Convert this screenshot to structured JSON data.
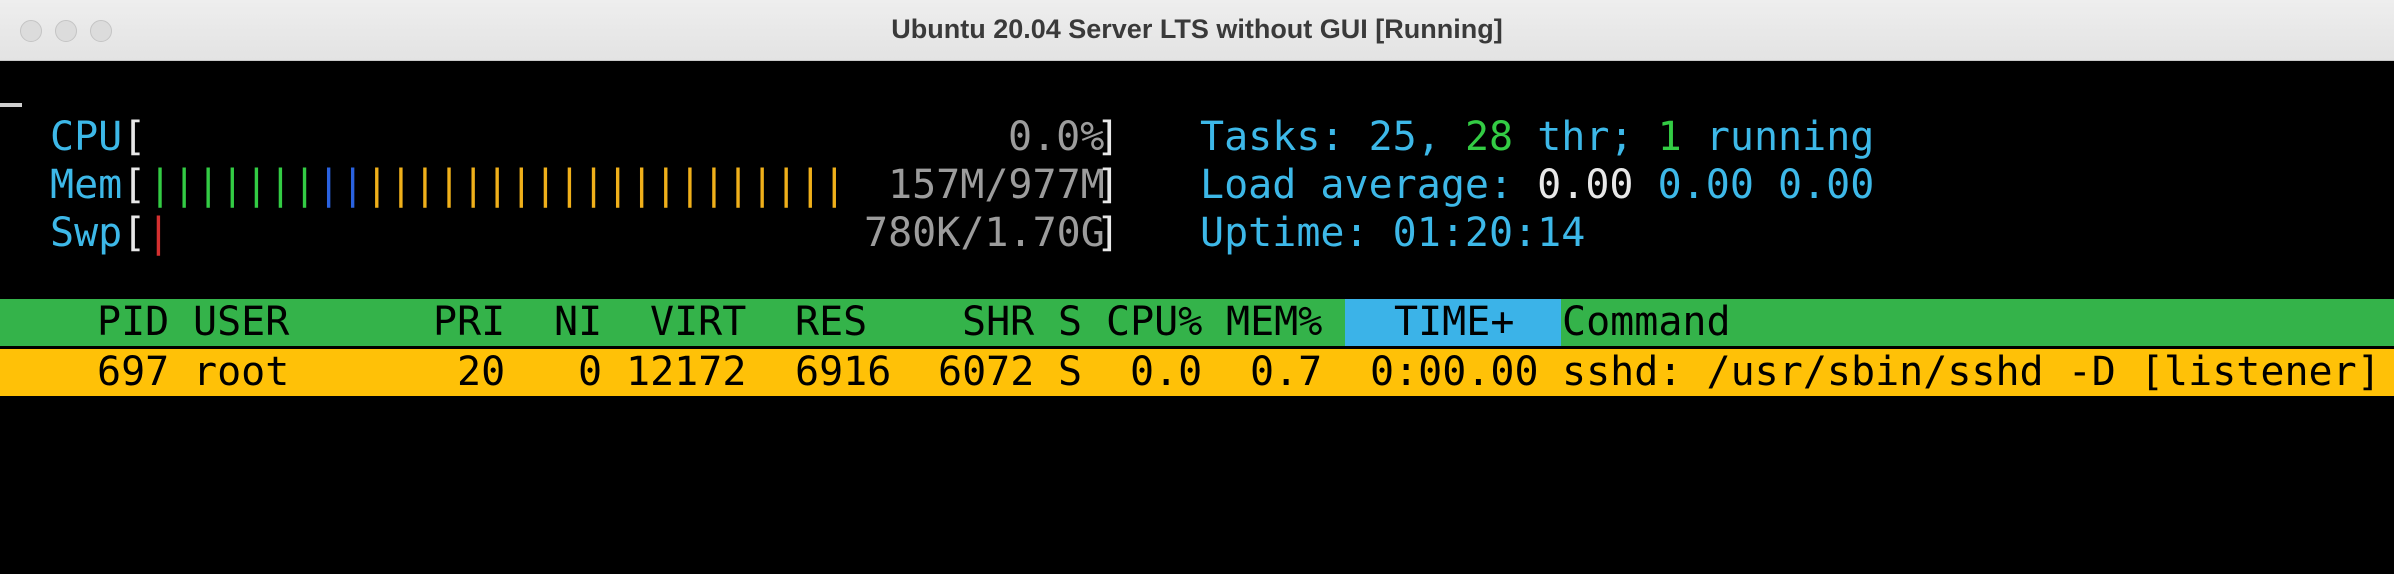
{
  "window": {
    "title": "Ubuntu 20.04 Server LTS without GUI [Running]"
  },
  "meters": {
    "cpu": {
      "label": "CPU",
      "value": "0.0%",
      "fill_fraction": 0.0
    },
    "mem": {
      "label": "Mem",
      "value": "157M/977M",
      "bar_green": 7,
      "bar_blue": 2,
      "bar_yellow": 20
    },
    "swp": {
      "label": "Swp",
      "value": "780K/1.70G",
      "bar_red": 1
    }
  },
  "summary": {
    "tasks_label": "Tasks:",
    "tasks_count": "25,",
    "threads_count": "28",
    "threads_label": "thr;",
    "running_count": "1",
    "running_label": "running",
    "load_label": "Load average:",
    "load_1": "0.00",
    "load_5": "0.00",
    "load_15": "0.00",
    "uptime_label": "Uptime:",
    "uptime_value": "01:20:14"
  },
  "process_table": {
    "columns": [
      "PID",
      "USER",
      "PRI",
      "NI",
      "VIRT",
      "RES",
      "SHR",
      "S",
      "CPU%",
      "MEM%",
      "TIME+",
      "Command"
    ],
    "rows": [
      {
        "pid": "697",
        "user": "root",
        "pri": "20",
        "ni": "0",
        "virt": "12172",
        "res": "6916",
        "shr": "6072",
        "s": "S",
        "cpu": "0.0",
        "mem": "0.7",
        "time": "0:00.00",
        "command": "sshd: /usr/sbin/sshd -D [listener]"
      }
    ]
  },
  "colors": {
    "header_bg": "#34b34a",
    "selected_row_bg": "#ffc107",
    "sort_column_bg": "#3bb3e8",
    "label_cyan": "#3db8e8"
  }
}
